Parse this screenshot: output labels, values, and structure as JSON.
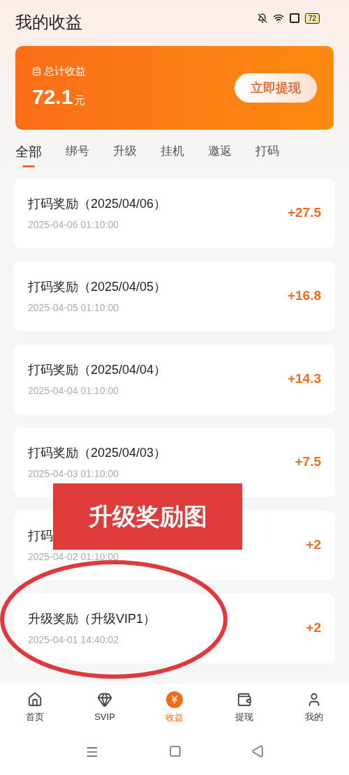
{
  "header": {
    "title": "我的收益",
    "battery": "72"
  },
  "summary": {
    "label": "总计收益",
    "amount": "72.1",
    "unit": "元",
    "button": "立即提现"
  },
  "tabs": [
    {
      "label": "全部",
      "selected": true
    },
    {
      "label": "绑号",
      "selected": false
    },
    {
      "label": "升级",
      "selected": false
    },
    {
      "label": "挂机",
      "selected": false
    },
    {
      "label": "邀返",
      "selected": false
    },
    {
      "label": "打码",
      "selected": false
    }
  ],
  "records": [
    {
      "title": "打码奖励（2025/04/06）",
      "time": "2025-04-06 01:10:00",
      "amount": "+27.5"
    },
    {
      "title": "打码奖励（2025/04/05）",
      "time": "2025-04-05 01:10:00",
      "amount": "+16.8"
    },
    {
      "title": "打码奖励（2025/04/04）",
      "time": "2025-04-04 01:10:00",
      "amount": "+14.3"
    },
    {
      "title": "打码奖励（2025/04/03）",
      "time": "2025-04-03 01:10:00",
      "amount": "+7.5"
    },
    {
      "title": "打码",
      "time": "2025-04-02 01:10:00",
      "amount": "+2"
    },
    {
      "title": "升级奖励（升级VIP1）",
      "time": "2025-04-01 14:40:02",
      "amount": "+2"
    }
  ],
  "annotation": {
    "label": "升级奖励图"
  },
  "bottom_nav": [
    {
      "label": "首页",
      "kind": "home",
      "selected": false
    },
    {
      "label": "SVIP",
      "kind": "diamond",
      "selected": false
    },
    {
      "label": "收益",
      "kind": "yen",
      "selected": true
    },
    {
      "label": "提现",
      "kind": "wallet",
      "selected": false
    },
    {
      "label": "我的",
      "kind": "user",
      "selected": false
    }
  ]
}
